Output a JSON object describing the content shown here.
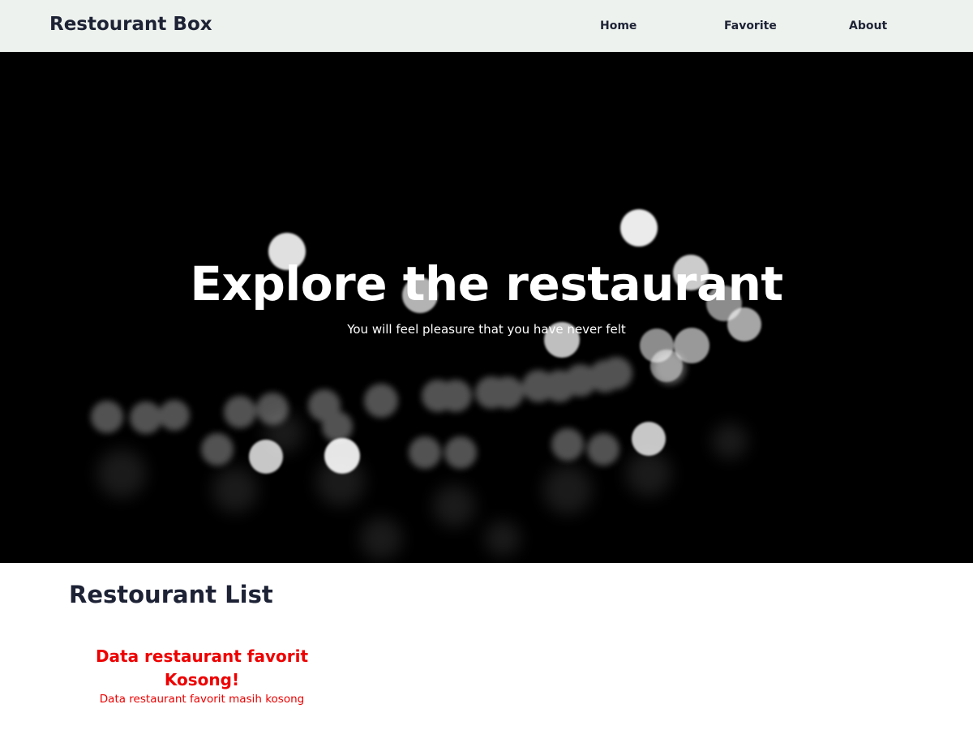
{
  "header": {
    "brand": "Restourant Box",
    "nav": [
      {
        "label": "Home"
      },
      {
        "label": "Favorite"
      },
      {
        "label": "About"
      }
    ]
  },
  "hero": {
    "title": "Explore the restaurant",
    "subtitle": "You will feel pleasure that you have never felt"
  },
  "main": {
    "section_title": "Restourant List",
    "empty_state": {
      "title": "Data restaurant favorit Kosong!",
      "description": "Data restaurant favorit masih kosong"
    }
  },
  "colors": {
    "navbar_bg": "#eef2ee",
    "text_dark": "#1d2235",
    "error_red": "#ee0000",
    "hero_bg": "#000000"
  }
}
